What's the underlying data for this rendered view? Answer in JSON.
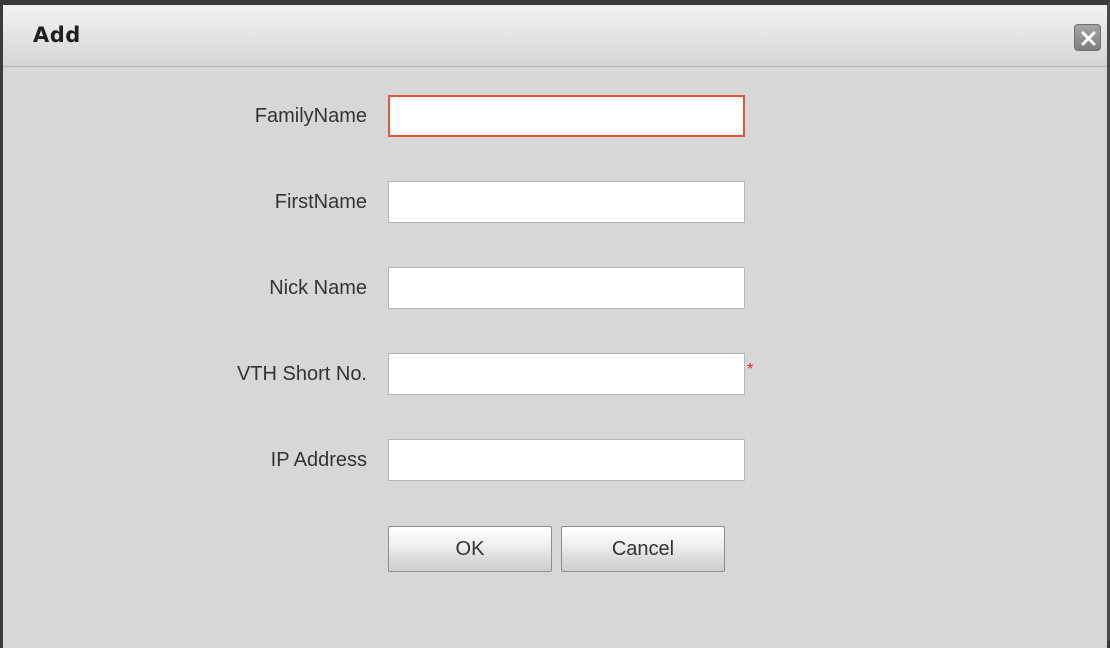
{
  "dialog": {
    "title": "Add",
    "close_icon": "close-icon"
  },
  "form": {
    "fields": [
      {
        "label": "FamilyName",
        "value": "",
        "placeholder": "",
        "required": false,
        "state": "invalid"
      },
      {
        "label": "FirstName",
        "value": "",
        "placeholder": "",
        "required": false
      },
      {
        "label": "Nick Name",
        "value": "",
        "placeholder": "",
        "required": false
      },
      {
        "label": "VTH Short No.",
        "value": "",
        "placeholder": "",
        "required": true,
        "required_mark": "*"
      },
      {
        "label": "IP Address",
        "value": "",
        "placeholder": "",
        "required": false
      }
    ]
  },
  "buttons": {
    "ok_label": "OK",
    "cancel_label": "Cancel"
  },
  "colors": {
    "dialog_background": "#d7d7d7",
    "invalid_border": "#e8543a",
    "required_mark": "#e8202a",
    "frame": "#3a3a3a"
  }
}
